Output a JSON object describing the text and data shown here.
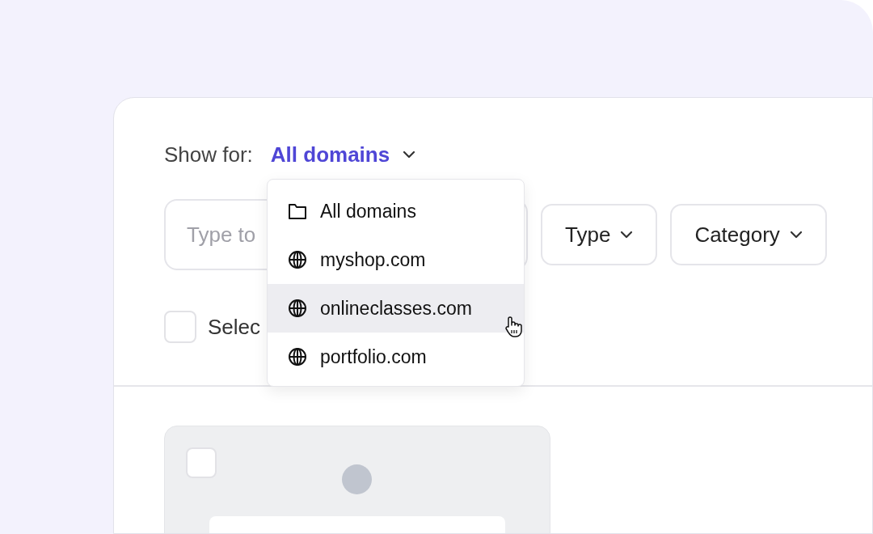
{
  "show_for": {
    "label": "Show for:",
    "value": "All domains"
  },
  "domain_menu": {
    "items": [
      {
        "label": "All domains",
        "kind": "folder",
        "highlighted": false
      },
      {
        "label": "myshop.com",
        "kind": "globe",
        "highlighted": false
      },
      {
        "label": "onlineclasses.com",
        "kind": "globe",
        "highlighted": true
      },
      {
        "label": "portfolio.com",
        "kind": "globe",
        "highlighted": false
      }
    ]
  },
  "search": {
    "placeholder": "Type to"
  },
  "filters": [
    "Type",
    "Category"
  ],
  "select_all": {
    "label": "Selec",
    "checked": false
  },
  "cards": [
    {
      "checked": false
    }
  ]
}
